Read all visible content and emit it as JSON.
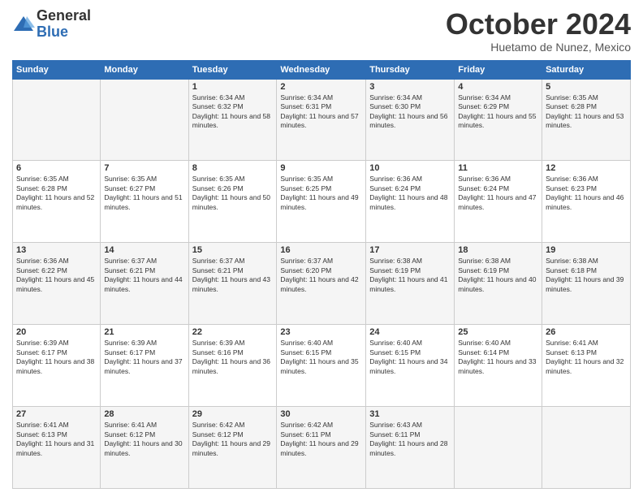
{
  "header": {
    "logo": {
      "general": "General",
      "blue": "Blue"
    },
    "title": "October 2024",
    "location": "Huetamo de Nunez, Mexico"
  },
  "days_of_week": [
    "Sunday",
    "Monday",
    "Tuesday",
    "Wednesday",
    "Thursday",
    "Friday",
    "Saturday"
  ],
  "weeks": [
    [
      {
        "day": "",
        "info": ""
      },
      {
        "day": "",
        "info": ""
      },
      {
        "day": "1",
        "info": "Sunrise: 6:34 AM\nSunset: 6:32 PM\nDaylight: 11 hours and 58 minutes."
      },
      {
        "day": "2",
        "info": "Sunrise: 6:34 AM\nSunset: 6:31 PM\nDaylight: 11 hours and 57 minutes."
      },
      {
        "day": "3",
        "info": "Sunrise: 6:34 AM\nSunset: 6:30 PM\nDaylight: 11 hours and 56 minutes."
      },
      {
        "day": "4",
        "info": "Sunrise: 6:34 AM\nSunset: 6:29 PM\nDaylight: 11 hours and 55 minutes."
      },
      {
        "day": "5",
        "info": "Sunrise: 6:35 AM\nSunset: 6:28 PM\nDaylight: 11 hours and 53 minutes."
      }
    ],
    [
      {
        "day": "6",
        "info": "Sunrise: 6:35 AM\nSunset: 6:28 PM\nDaylight: 11 hours and 52 minutes."
      },
      {
        "day": "7",
        "info": "Sunrise: 6:35 AM\nSunset: 6:27 PM\nDaylight: 11 hours and 51 minutes."
      },
      {
        "day": "8",
        "info": "Sunrise: 6:35 AM\nSunset: 6:26 PM\nDaylight: 11 hours and 50 minutes."
      },
      {
        "day": "9",
        "info": "Sunrise: 6:35 AM\nSunset: 6:25 PM\nDaylight: 11 hours and 49 minutes."
      },
      {
        "day": "10",
        "info": "Sunrise: 6:36 AM\nSunset: 6:24 PM\nDaylight: 11 hours and 48 minutes."
      },
      {
        "day": "11",
        "info": "Sunrise: 6:36 AM\nSunset: 6:24 PM\nDaylight: 11 hours and 47 minutes."
      },
      {
        "day": "12",
        "info": "Sunrise: 6:36 AM\nSunset: 6:23 PM\nDaylight: 11 hours and 46 minutes."
      }
    ],
    [
      {
        "day": "13",
        "info": "Sunrise: 6:36 AM\nSunset: 6:22 PM\nDaylight: 11 hours and 45 minutes."
      },
      {
        "day": "14",
        "info": "Sunrise: 6:37 AM\nSunset: 6:21 PM\nDaylight: 11 hours and 44 minutes."
      },
      {
        "day": "15",
        "info": "Sunrise: 6:37 AM\nSunset: 6:21 PM\nDaylight: 11 hours and 43 minutes."
      },
      {
        "day": "16",
        "info": "Sunrise: 6:37 AM\nSunset: 6:20 PM\nDaylight: 11 hours and 42 minutes."
      },
      {
        "day": "17",
        "info": "Sunrise: 6:38 AM\nSunset: 6:19 PM\nDaylight: 11 hours and 41 minutes."
      },
      {
        "day": "18",
        "info": "Sunrise: 6:38 AM\nSunset: 6:19 PM\nDaylight: 11 hours and 40 minutes."
      },
      {
        "day": "19",
        "info": "Sunrise: 6:38 AM\nSunset: 6:18 PM\nDaylight: 11 hours and 39 minutes."
      }
    ],
    [
      {
        "day": "20",
        "info": "Sunrise: 6:39 AM\nSunset: 6:17 PM\nDaylight: 11 hours and 38 minutes."
      },
      {
        "day": "21",
        "info": "Sunrise: 6:39 AM\nSunset: 6:17 PM\nDaylight: 11 hours and 37 minutes."
      },
      {
        "day": "22",
        "info": "Sunrise: 6:39 AM\nSunset: 6:16 PM\nDaylight: 11 hours and 36 minutes."
      },
      {
        "day": "23",
        "info": "Sunrise: 6:40 AM\nSunset: 6:15 PM\nDaylight: 11 hours and 35 minutes."
      },
      {
        "day": "24",
        "info": "Sunrise: 6:40 AM\nSunset: 6:15 PM\nDaylight: 11 hours and 34 minutes."
      },
      {
        "day": "25",
        "info": "Sunrise: 6:40 AM\nSunset: 6:14 PM\nDaylight: 11 hours and 33 minutes."
      },
      {
        "day": "26",
        "info": "Sunrise: 6:41 AM\nSunset: 6:13 PM\nDaylight: 11 hours and 32 minutes."
      }
    ],
    [
      {
        "day": "27",
        "info": "Sunrise: 6:41 AM\nSunset: 6:13 PM\nDaylight: 11 hours and 31 minutes."
      },
      {
        "day": "28",
        "info": "Sunrise: 6:41 AM\nSunset: 6:12 PM\nDaylight: 11 hours and 30 minutes."
      },
      {
        "day": "29",
        "info": "Sunrise: 6:42 AM\nSunset: 6:12 PM\nDaylight: 11 hours and 29 minutes."
      },
      {
        "day": "30",
        "info": "Sunrise: 6:42 AM\nSunset: 6:11 PM\nDaylight: 11 hours and 29 minutes."
      },
      {
        "day": "31",
        "info": "Sunrise: 6:43 AM\nSunset: 6:11 PM\nDaylight: 11 hours and 28 minutes."
      },
      {
        "day": "",
        "info": ""
      },
      {
        "day": "",
        "info": ""
      }
    ]
  ]
}
